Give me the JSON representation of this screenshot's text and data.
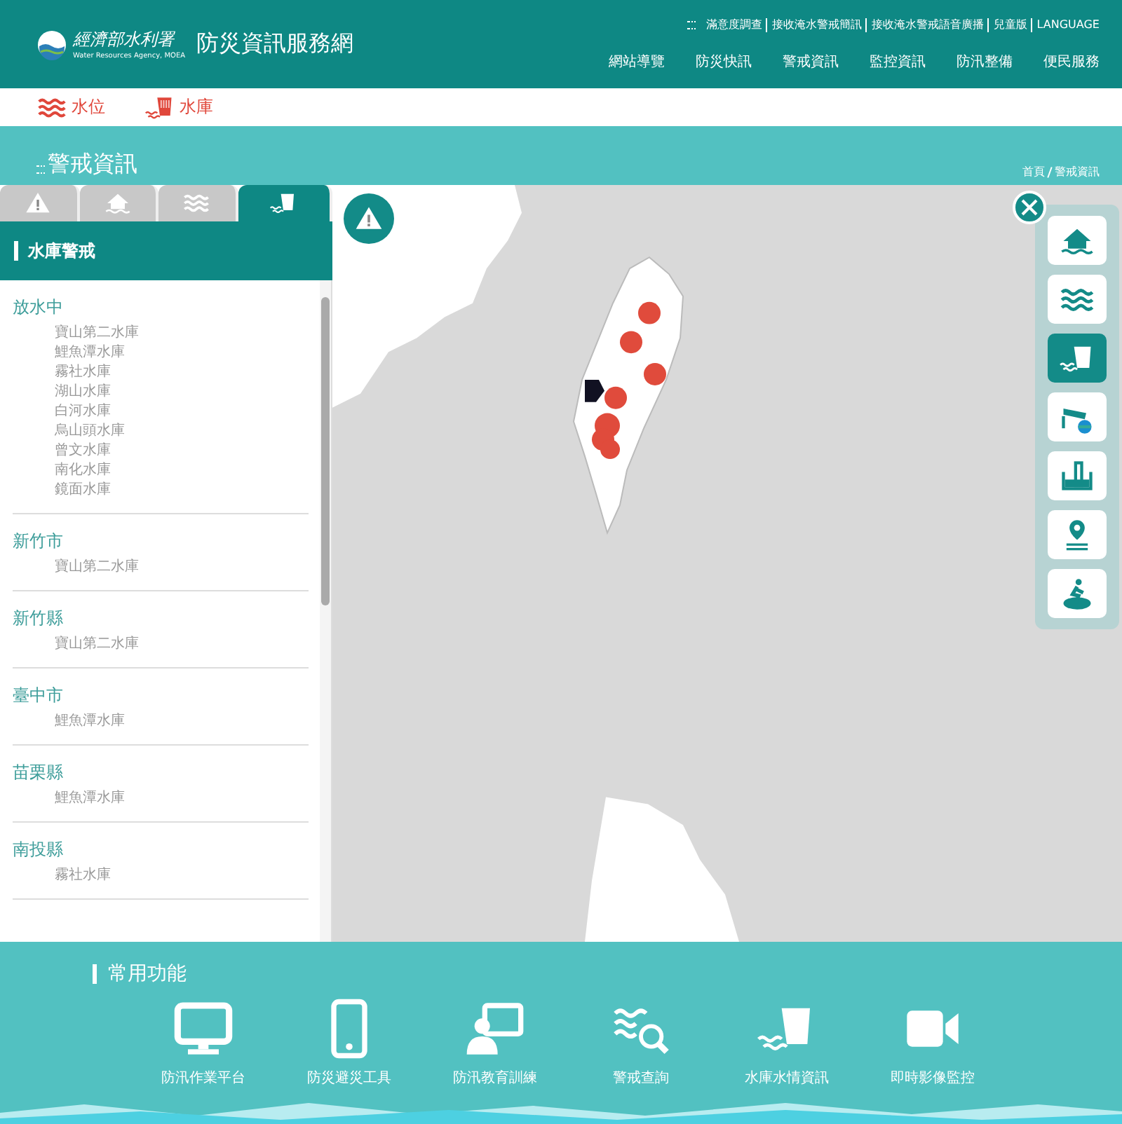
{
  "header": {
    "logo_text": "經濟部水利署",
    "logo_subtext": "Water Resources Agency, MOEA",
    "site_title": "防災資訊服務網",
    "top_links": [
      "滿意度調查",
      "接收淹水警戒簡訊",
      "接收淹水警戒語音廣播",
      "兒童版",
      "LANGUAGE"
    ],
    "nav": [
      "網站導覽",
      "防災快訊",
      "警戒資訊",
      "監控資訊",
      "防汛整備",
      "便民服務"
    ]
  },
  "subnav": [
    {
      "kind": "waves",
      "label": "水位"
    },
    {
      "kind": "dam",
      "label": "水庫"
    }
  ],
  "page_title": "警戒資訊",
  "breadcrumb": [
    "首頁",
    "警戒資訊"
  ],
  "sidebar": {
    "tabs": [
      {
        "kind": "warning",
        "selected": false
      },
      {
        "kind": "house",
        "selected": false
      },
      {
        "kind": "waves",
        "selected": false
      },
      {
        "kind": "dam",
        "selected": true
      }
    ],
    "heading": "水庫警戒",
    "groups": [
      {
        "name": "放水中",
        "items": [
          "寶山第二水庫",
          "鯉魚潭水庫",
          "霧社水庫",
          "湖山水庫",
          "白河水庫",
          "烏山頭水庫",
          "曾文水庫",
          "南化水庫",
          "鏡面水庫"
        ]
      },
      {
        "name": "新竹市",
        "items": [
          "寶山第二水庫"
        ]
      },
      {
        "name": "新竹縣",
        "items": [
          "寶山第二水庫"
        ]
      },
      {
        "name": "臺中市",
        "items": [
          "鯉魚潭水庫"
        ]
      },
      {
        "name": "苗栗縣",
        "items": [
          "鯉魚潭水庫"
        ]
      },
      {
        "name": "南投縣",
        "items": [
          "霧社水庫"
        ]
      }
    ]
  },
  "map_tools": [
    {
      "kind": "house",
      "selected": false
    },
    {
      "kind": "waves",
      "selected": false
    },
    {
      "kind": "dam",
      "selected": true
    },
    {
      "kind": "camera",
      "selected": false
    },
    {
      "kind": "gauge",
      "selected": false
    },
    {
      "kind": "pin",
      "selected": false
    },
    {
      "kind": "person",
      "selected": false
    }
  ],
  "footer": {
    "heading": "常用功能",
    "items": [
      {
        "kind": "monitor",
        "label": "防汛作業平台"
      },
      {
        "kind": "phone",
        "label": "防災避災工具"
      },
      {
        "kind": "teacher",
        "label": "防汛教育訓練"
      },
      {
        "kind": "search-waves",
        "label": "警戒查詢"
      },
      {
        "kind": "dam",
        "label": "水庫水情資訊"
      },
      {
        "kind": "video",
        "label": "即時影像監控"
      }
    ]
  }
}
